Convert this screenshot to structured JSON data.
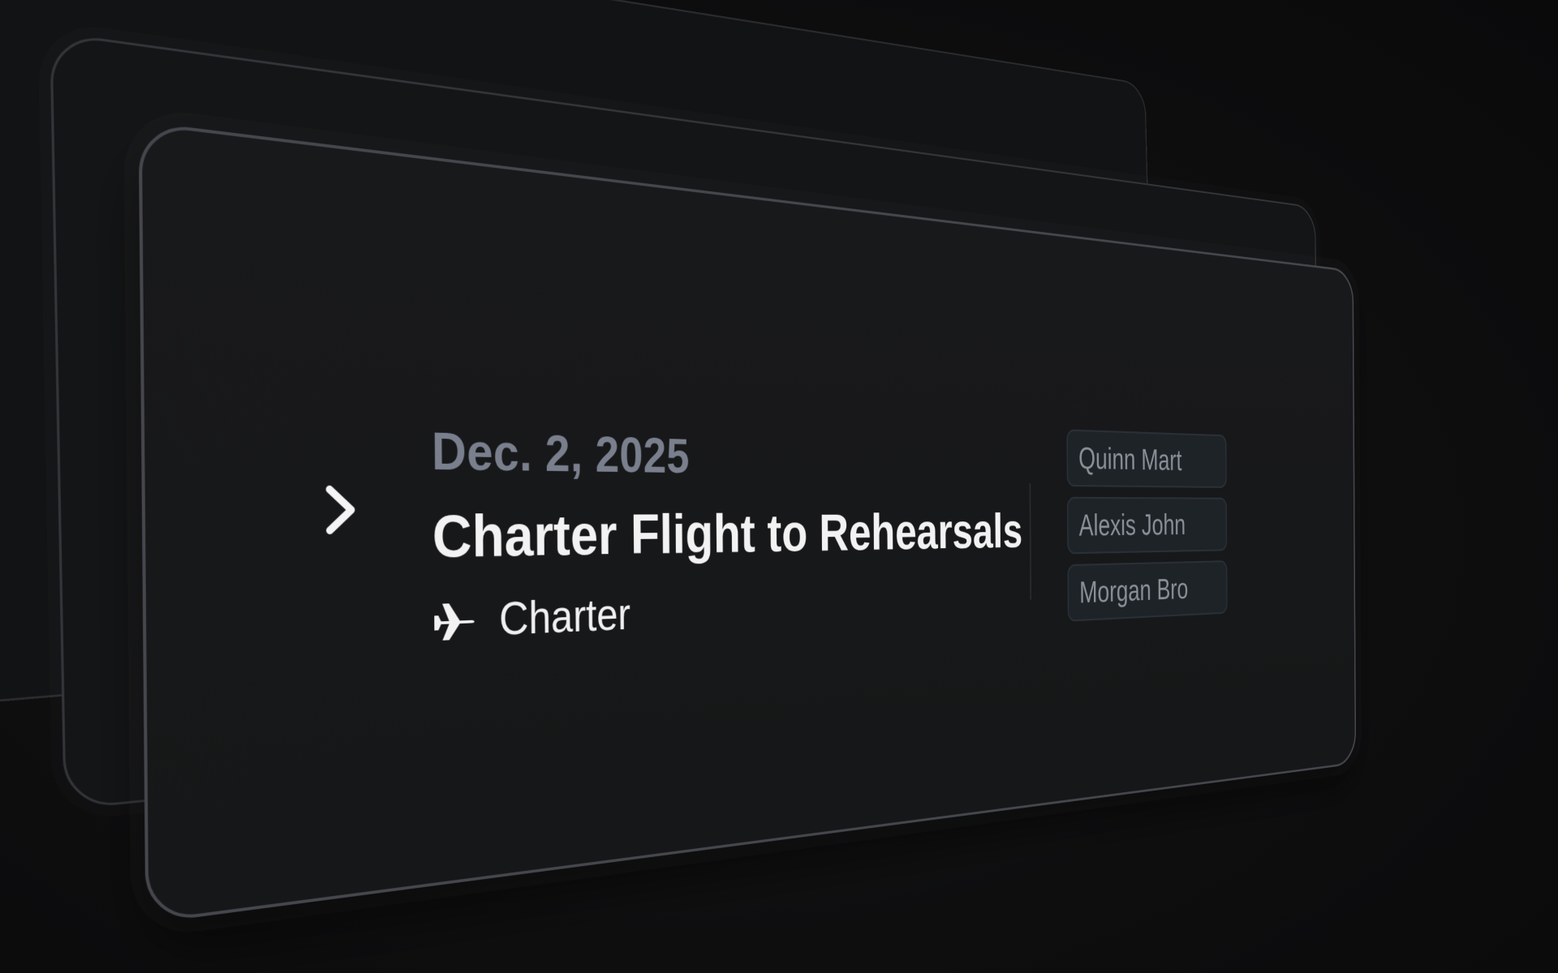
{
  "event": {
    "date": "Dec. 2, 2025",
    "title": "Charter Flight to Rehearsals",
    "type_label": "Charter",
    "type_icon": "airplane-icon",
    "expand_icon": "chevron-right-icon"
  },
  "participants": [
    {
      "name": "Quinn Mart"
    },
    {
      "name": "Alexis John"
    },
    {
      "name": "Morgan Bro"
    }
  ],
  "colors": {
    "background": "#0d0d0e",
    "card": "#18191b",
    "card_border": "#46474d",
    "date_text": "#7a7f8d",
    "title_text": "#f2f2f3",
    "chip_background": "#1d2327",
    "chip_text": "#8a8f98"
  }
}
